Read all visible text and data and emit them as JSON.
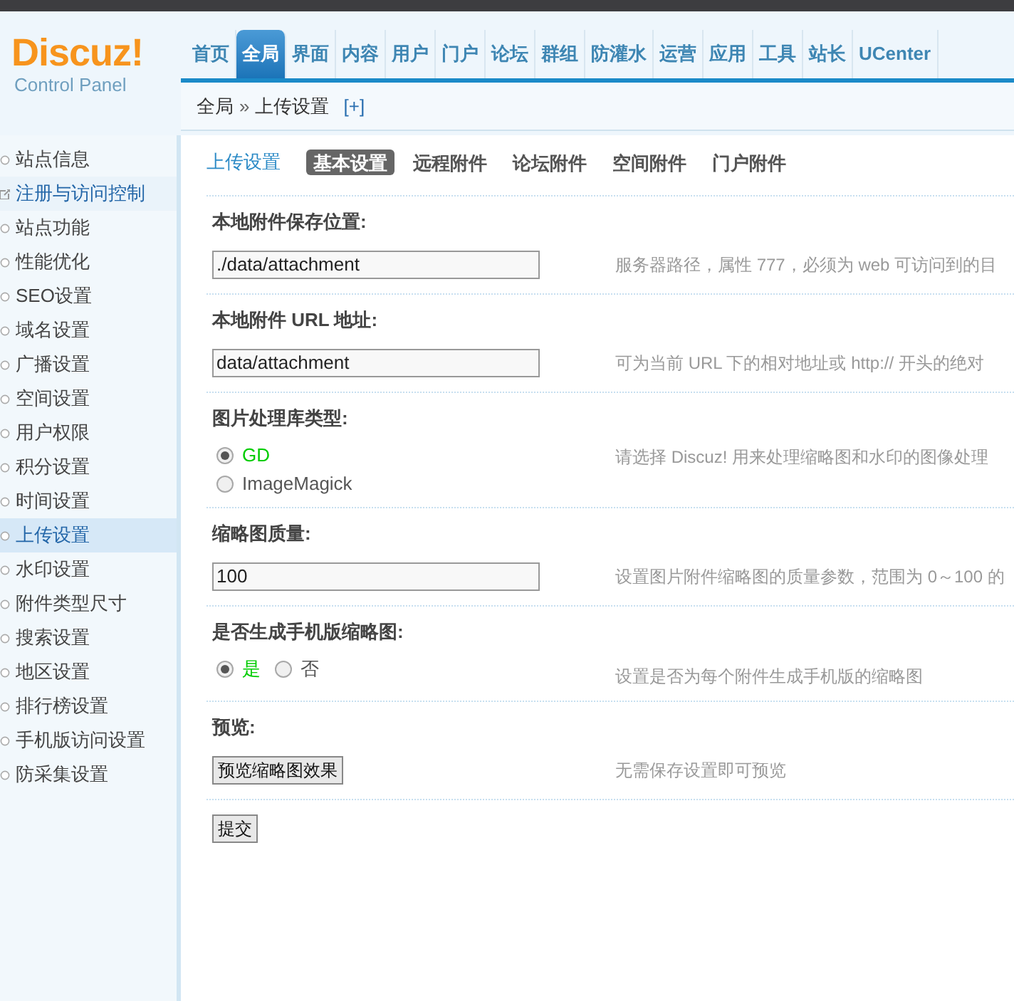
{
  "top_nav": {
    "logo": "Discuz!",
    "logo_subtitle": "Control Panel",
    "tabs": [
      {
        "label": "首页",
        "selected": false
      },
      {
        "label": "全局",
        "selected": true
      },
      {
        "label": "界面",
        "selected": false
      },
      {
        "label": "内容",
        "selected": false
      },
      {
        "label": "用户",
        "selected": false
      },
      {
        "label": "门户",
        "selected": false
      },
      {
        "label": "论坛",
        "selected": false
      },
      {
        "label": "群组",
        "selected": false
      },
      {
        "label": "防灌水",
        "selected": false
      },
      {
        "label": "运营",
        "selected": false
      },
      {
        "label": "应用",
        "selected": false
      },
      {
        "label": "工具",
        "selected": false
      },
      {
        "label": "站长",
        "selected": false
      },
      {
        "label": "UCenter",
        "selected": false
      }
    ]
  },
  "breadcrumb": {
    "items": [
      "全局",
      "上传设置"
    ],
    "separator": "»",
    "add": "[+]"
  },
  "sidebar": {
    "items": [
      {
        "label": "站点信息",
        "selected": false,
        "hovered": false
      },
      {
        "label": "注册与访问控制",
        "selected": false,
        "hovered": true
      },
      {
        "label": "站点功能",
        "selected": false,
        "hovered": false
      },
      {
        "label": "性能优化",
        "selected": false,
        "hovered": false
      },
      {
        "label": "SEO设置",
        "selected": false,
        "hovered": false
      },
      {
        "label": "域名设置",
        "selected": false,
        "hovered": false
      },
      {
        "label": "广播设置",
        "selected": false,
        "hovered": false
      },
      {
        "label": "空间设置",
        "selected": false,
        "hovered": false
      },
      {
        "label": "用户权限",
        "selected": false,
        "hovered": false
      },
      {
        "label": "积分设置",
        "selected": false,
        "hovered": false
      },
      {
        "label": "时间设置",
        "selected": false,
        "hovered": false
      },
      {
        "label": "上传设置",
        "selected": true,
        "hovered": false
      },
      {
        "label": "水印设置",
        "selected": false,
        "hovered": false
      },
      {
        "label": "附件类型尺寸",
        "selected": false,
        "hovered": false
      },
      {
        "label": "搜索设置",
        "selected": false,
        "hovered": false
      },
      {
        "label": "地区设置",
        "selected": false,
        "hovered": false
      },
      {
        "label": "排行榜设置",
        "selected": false,
        "hovered": false
      },
      {
        "label": "手机版访问设置",
        "selected": false,
        "hovered": false
      },
      {
        "label": "防采集设置",
        "selected": false,
        "hovered": false
      }
    ]
  },
  "page": {
    "title": "上传设置",
    "tabs": [
      {
        "label": "基本设置",
        "selected": true
      },
      {
        "label": "远程附件",
        "selected": false
      },
      {
        "label": "论坛附件",
        "selected": false
      },
      {
        "label": "空间附件",
        "selected": false
      },
      {
        "label": "门户附件",
        "selected": false
      }
    ],
    "settings": [
      {
        "kind": "text",
        "label": "本地附件保存位置:",
        "value": "./data/attachment",
        "hint": "服务器路径，属性 777，必须为 web 可访问到的目"
      },
      {
        "kind": "text",
        "label": "本地附件 URL 地址:",
        "value": "data/attachment",
        "hint": "可为当前 URL 下的相对地址或 http:// 开头的绝对"
      },
      {
        "kind": "radio_stacked",
        "label": "图片处理库类型:",
        "options": [
          {
            "label": "GD",
            "selected": true
          },
          {
            "label": "ImageMagick",
            "selected": false
          }
        ],
        "hint": "请选择 Discuz! 用来处理缩略图和水印的图像处理"
      },
      {
        "kind": "text",
        "label": "缩略图质量:",
        "value": "100",
        "hint": "设置图片附件缩略图的质量参数，范围为 0～100 的"
      },
      {
        "kind": "radio_inline",
        "label": "是否生成手机版缩略图:",
        "options": [
          {
            "label": "是",
            "selected": true
          },
          {
            "label": "否",
            "selected": false
          }
        ],
        "hint": "设置是否为每个附件生成手机版的缩略图"
      },
      {
        "kind": "button",
        "label": "预览:",
        "button": "预览缩略图效果",
        "hint": "无需保存设置即可预览"
      }
    ],
    "submit": "提交"
  }
}
